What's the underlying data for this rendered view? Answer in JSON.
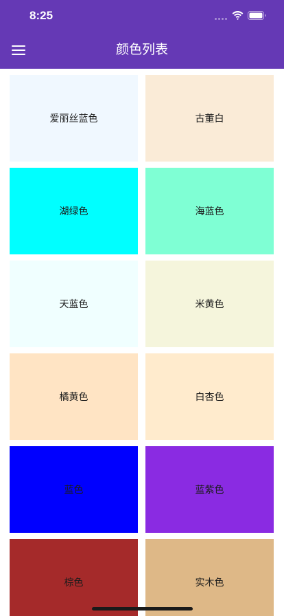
{
  "status_bar": {
    "time": "8:25"
  },
  "app_bar": {
    "title": "颜色列表",
    "menu_icon": "menu-icon",
    "background": "#6539b5"
  },
  "colors": [
    {
      "name": "爱丽丝蓝色",
      "hex": "#f0f8ff"
    },
    {
      "name": "古董白",
      "hex": "#faebd7"
    },
    {
      "name": "湖绿色",
      "hex": "#00ffff"
    },
    {
      "name": "海蓝色",
      "hex": "#7fffd4"
    },
    {
      "name": "天蓝色",
      "hex": "#f0ffff"
    },
    {
      "name": "米黄色",
      "hex": "#f5f5dc"
    },
    {
      "name": "橘黄色",
      "hex": "#ffe4c4"
    },
    {
      "name": "白杏色",
      "hex": "#ffebcd"
    },
    {
      "name": "蓝色",
      "hex": "#0000ff"
    },
    {
      "name": "蓝紫色",
      "hex": "#8a2be2"
    },
    {
      "name": "棕色",
      "hex": "#a52a2a"
    },
    {
      "name": "实木色",
      "hex": "#deb887"
    }
  ]
}
